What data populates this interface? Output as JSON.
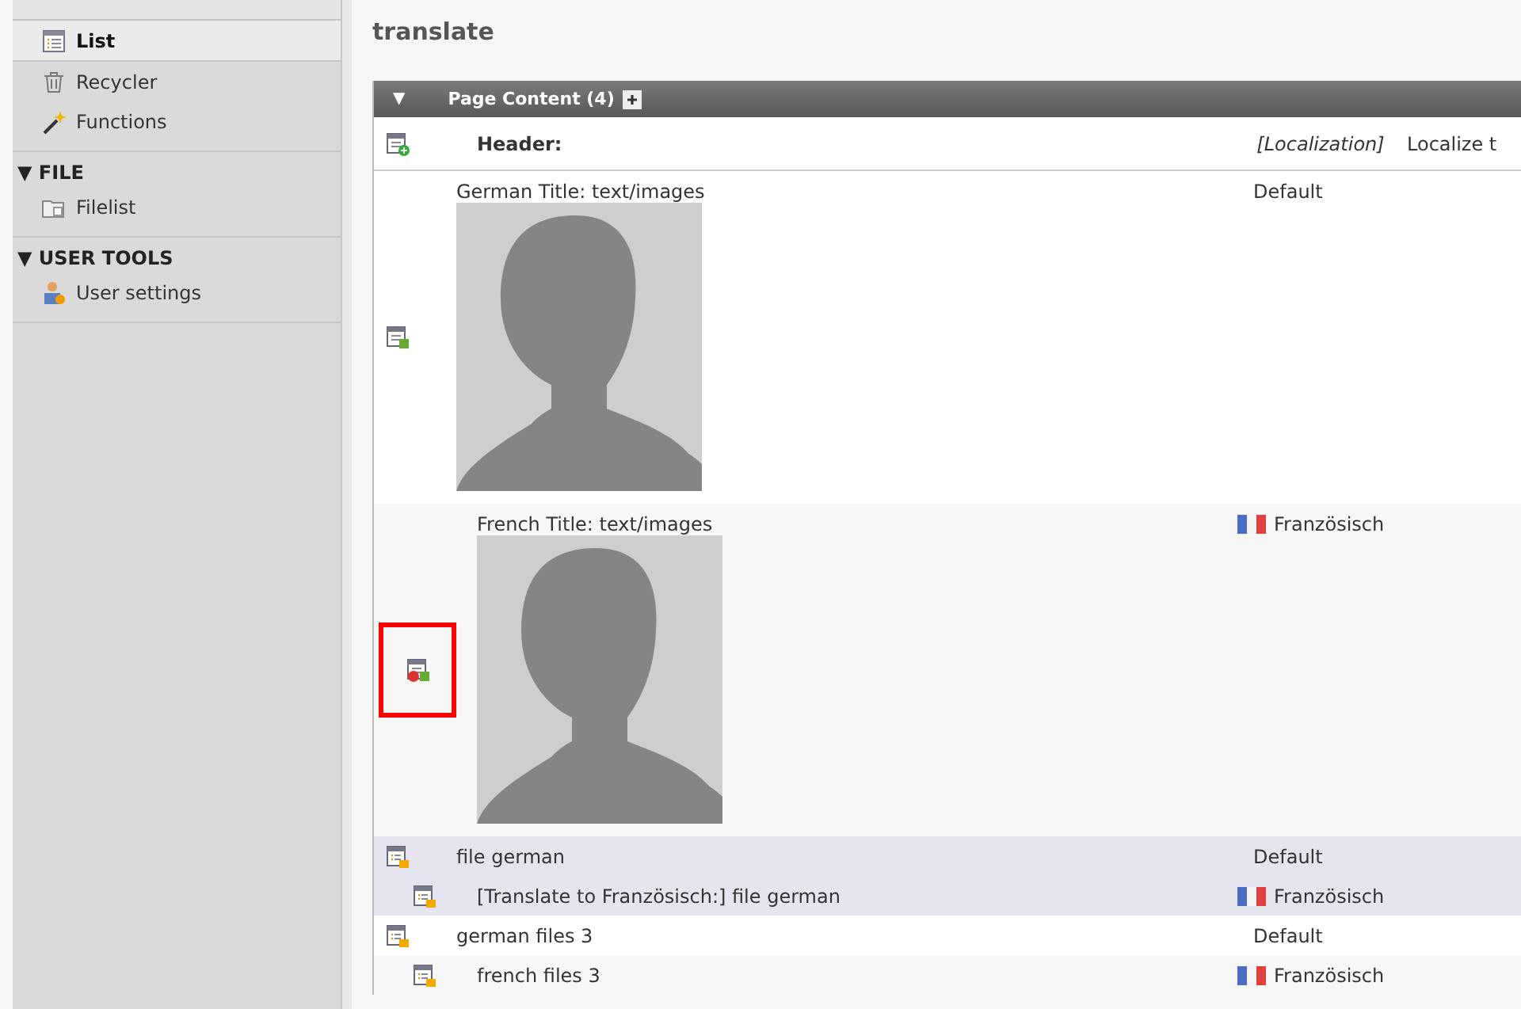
{
  "sidebar": {
    "items_top": [
      {
        "label": "List",
        "selected": true
      },
      {
        "label": "Recycler",
        "selected": false
      },
      {
        "label": "Functions",
        "selected": false
      }
    ],
    "sections": [
      {
        "toggle": "▼",
        "title": "FILE",
        "items": [
          {
            "label": "Filelist",
            "selected": false
          }
        ]
      },
      {
        "toggle": "▼",
        "title": "USER TOOLS",
        "items": [
          {
            "label": "User settings",
            "selected": false
          }
        ]
      }
    ]
  },
  "page": {
    "title": "translate",
    "table": {
      "toggle": "▼",
      "title": "Page Content (4)",
      "header": {
        "label": "Header:",
        "localization": "[Localization]",
        "localize_to": "Localize t"
      },
      "rows": [
        {
          "title": "German Title: text/images",
          "language": "Default",
          "flag": false,
          "translated": false,
          "highlighted": false,
          "marked": false
        },
        {
          "title": "French Title: text/images",
          "language": "Französisch",
          "flag": true,
          "translated": true,
          "highlighted": false,
          "marked": true
        },
        {
          "kind": "file",
          "title": "file german",
          "language": "Default",
          "flag": false,
          "translated": false,
          "highlighted": true,
          "marked": false
        },
        {
          "kind": "file",
          "title": "[Translate to Französisch:] file german",
          "language": "Französisch",
          "flag": true,
          "translated": true,
          "highlighted": true,
          "marked": false
        },
        {
          "kind": "file",
          "title": "german files 3",
          "language": "Default",
          "flag": false,
          "translated": false,
          "highlighted": false,
          "marked": false
        },
        {
          "kind": "file",
          "title": "french files 3",
          "language": "Französisch",
          "flag": true,
          "translated": true,
          "highlighted": false,
          "marked": false
        }
      ]
    }
  }
}
